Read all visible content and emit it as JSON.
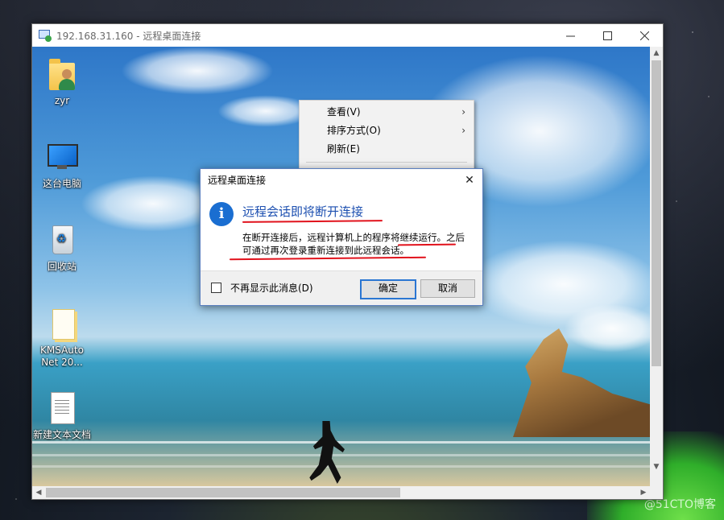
{
  "host": {
    "watermark": "@51CTO博客"
  },
  "window": {
    "title": "192.168.31.160 - 远程桌面连接",
    "icon": "remote-desktop-icon",
    "controls": [
      "minimize-icon",
      "maximize-icon",
      "close-icon"
    ]
  },
  "desktop": {
    "icons": [
      {
        "label": "zyr",
        "icon": "user-folder-icon"
      },
      {
        "label": "这台电脑",
        "icon": "this-pc-icon"
      },
      {
        "label": "回收站",
        "icon": "recycle-bin-icon"
      },
      {
        "label": "KMSAuto Net 20...",
        "icon": "folder-icon"
      },
      {
        "label": "新建文本文档",
        "icon": "text-document-icon"
      }
    ]
  },
  "context_menu": {
    "items": [
      {
        "label": "查看(V)",
        "submenu": true
      },
      {
        "label": "排序方式(O)",
        "submenu": true
      },
      {
        "label": "刷新(E)",
        "submenu": false
      }
    ]
  },
  "dialog": {
    "title": "远程桌面连接",
    "icon": "info-icon",
    "heading": "远程会话即将断开连接",
    "body_line1": "在断开连接后，远程计算机上的程序将继续运行。之后",
    "body_line2": "可通过再次登录重新连接到此远程会话。",
    "checkbox_label": "不再显示此消息(D)",
    "checkbox_checked": false,
    "ok_label": "确定",
    "cancel_label": "取消",
    "annotation_color": "#e1121c"
  },
  "colors": {
    "accent": "#1a6ed1",
    "heading": "#1c4fb0"
  }
}
